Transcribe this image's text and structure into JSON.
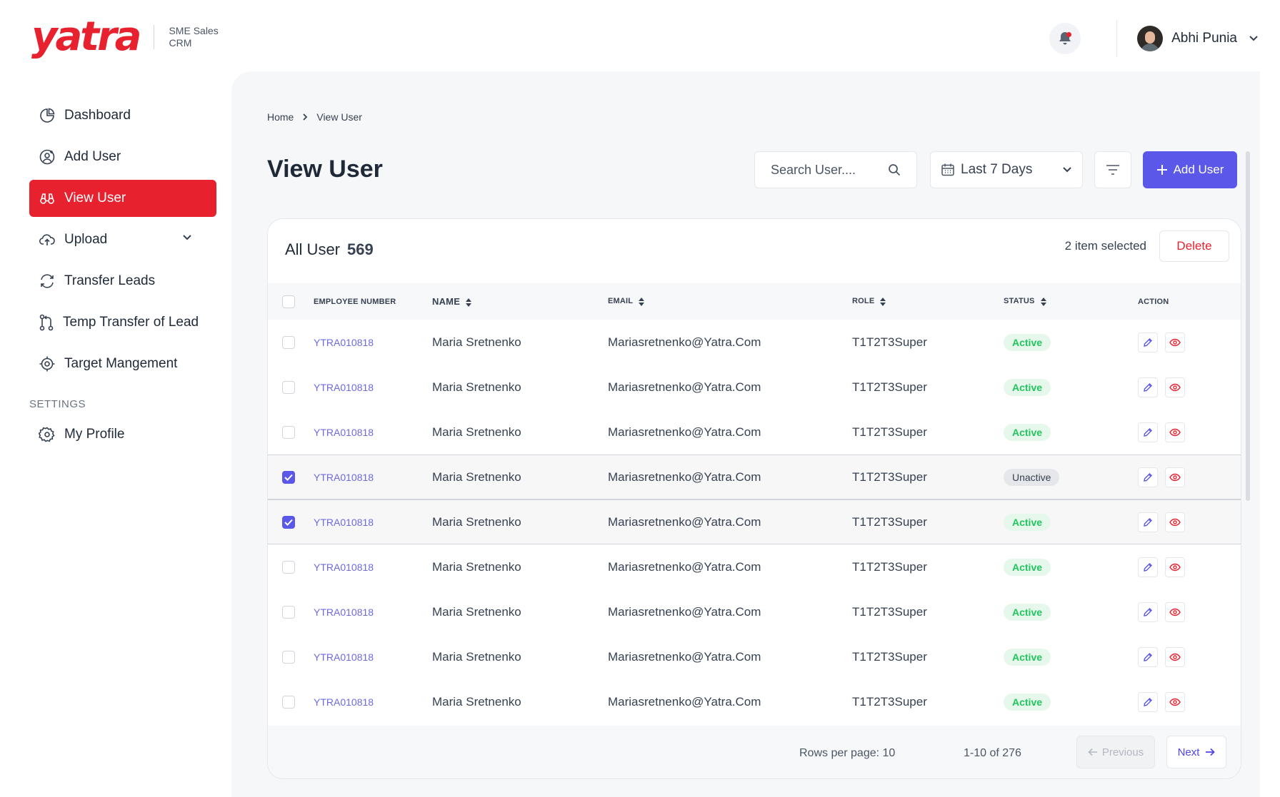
{
  "brand": {
    "logo_text": "yatra",
    "subtitle": "SME Sales CRM",
    "accent": "#e8212e",
    "primary": "#5b57e8"
  },
  "header": {
    "user_name": "Abhi Punia",
    "notification_icon": "bell-icon"
  },
  "sidebar": {
    "items": [
      {
        "label": "Dashboard",
        "icon": "pie-chart-icon"
      },
      {
        "label": "Add User",
        "icon": "add-user-icon"
      },
      {
        "label": "View User",
        "icon": "binoculars-icon",
        "active": true
      },
      {
        "label": "Upload",
        "icon": "cloud-upload-icon",
        "expandable": true
      },
      {
        "label": "Transfer Leads",
        "icon": "transfer-icon"
      },
      {
        "label": "Temp Transfer of Lead",
        "icon": "git-branch-icon"
      },
      {
        "label": "Target Mangement",
        "icon": "target-icon"
      }
    ],
    "settings_label": "SETTINGS",
    "settings_items": [
      {
        "label": "My Profile",
        "icon": "gear-icon"
      }
    ]
  },
  "breadcrumb": {
    "home": "Home",
    "current": "View User"
  },
  "page": {
    "title": "View User"
  },
  "toolbar": {
    "search_placeholder": "Search User....",
    "date_range": "Last 7 Days",
    "add_label": "Add User"
  },
  "card": {
    "title": "All User",
    "count": "569",
    "selected_text": "2 item selected",
    "delete_label": "Delete"
  },
  "table": {
    "headers": {
      "employee_number": "EMPLOYEE NUMBER",
      "name": "NAME",
      "email": "EMAIL",
      "role": "ROLE",
      "status": "STATUS",
      "action": "ACTION"
    },
    "rows": [
      {
        "emp": "YTRA010818",
        "name": "Maria Sretnenko",
        "email": "Mariasretnenko@Yatra.Com",
        "role": "T1T2T3Super",
        "status": "Active",
        "checked": false
      },
      {
        "emp": "YTRA010818",
        "name": "Maria Sretnenko",
        "email": "Mariasretnenko@Yatra.Com",
        "role": "T1T2T3Super",
        "status": "Active",
        "checked": false
      },
      {
        "emp": "YTRA010818",
        "name": "Maria Sretnenko",
        "email": "Mariasretnenko@Yatra.Com",
        "role": "T1T2T3Super",
        "status": "Active",
        "checked": false
      },
      {
        "emp": "YTRA010818",
        "name": "Maria Sretnenko",
        "email": "Mariasretnenko@Yatra.Com",
        "role": "T1T2T3Super",
        "status": "Unactive",
        "checked": true
      },
      {
        "emp": "YTRA010818",
        "name": "Maria Sretnenko",
        "email": "Mariasretnenko@Yatra.Com",
        "role": "T1T2T3Super",
        "status": "Active",
        "checked": true
      },
      {
        "emp": "YTRA010818",
        "name": "Maria Sretnenko",
        "email": "Mariasretnenko@Yatra.Com",
        "role": "T1T2T3Super",
        "status": "Active",
        "checked": false
      },
      {
        "emp": "YTRA010818",
        "name": "Maria Sretnenko",
        "email": "Mariasretnenko@Yatra.Com",
        "role": "T1T2T3Super",
        "status": "Active",
        "checked": false
      },
      {
        "emp": "YTRA010818",
        "name": "Maria Sretnenko",
        "email": "Mariasretnenko@Yatra.Com",
        "role": "T1T2T3Super",
        "status": "Active",
        "checked": false
      },
      {
        "emp": "YTRA010818",
        "name": "Maria Sretnenko",
        "email": "Mariasretnenko@Yatra.Com",
        "role": "T1T2T3Super",
        "status": "Active",
        "checked": false
      }
    ]
  },
  "pagination": {
    "rows_per_page": "Rows per page: 10",
    "range": "1-10 of 276",
    "previous": "Previous",
    "next": "Next"
  }
}
